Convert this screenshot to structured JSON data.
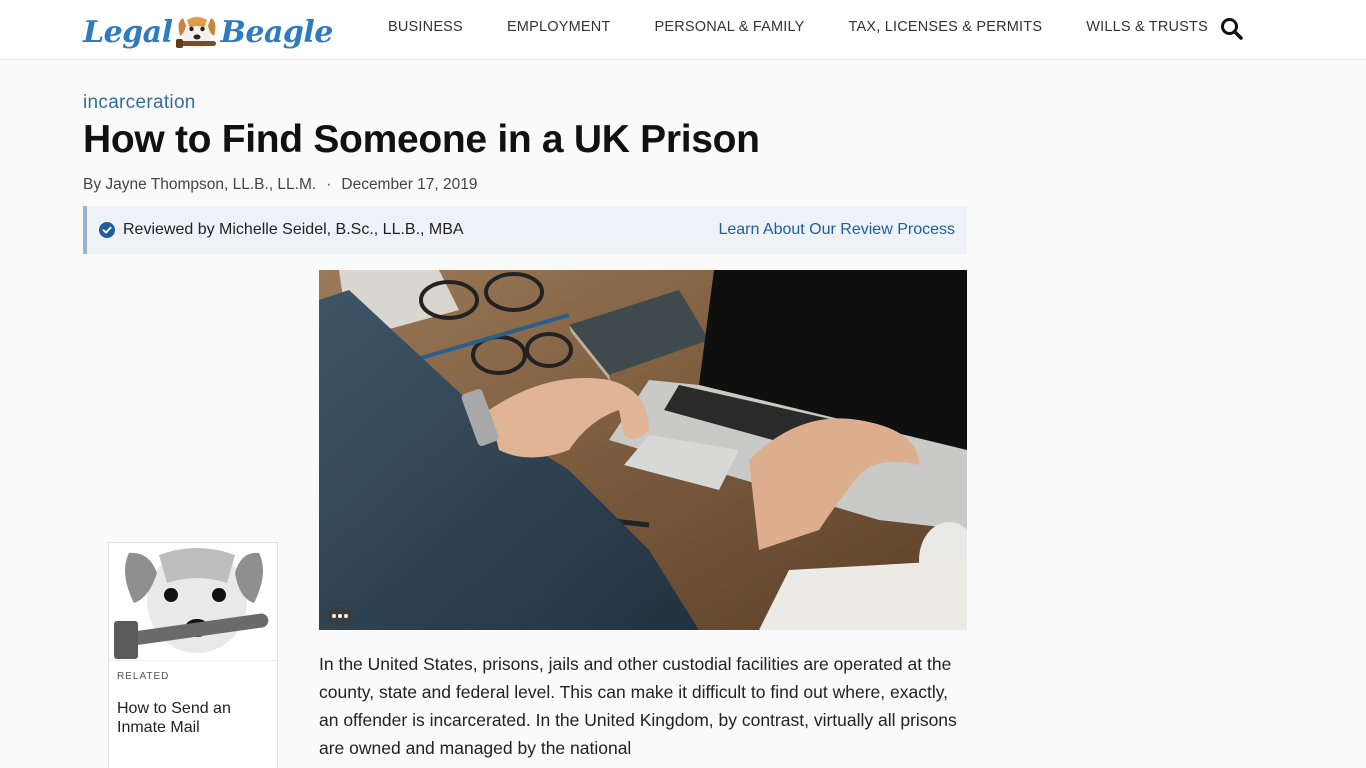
{
  "header": {
    "logo_left": "Legal",
    "logo_right": "Beagle",
    "nav": [
      {
        "label": "BUSINESS"
      },
      {
        "label": "EMPLOYMENT"
      },
      {
        "label": "PERSONAL & FAMILY"
      },
      {
        "label": "TAX, LICENSES & PERMITS"
      },
      {
        "label": "WILLS & TRUSTS"
      }
    ],
    "search_icon": "search-icon"
  },
  "article": {
    "category": "incarceration",
    "title": "How to Find Someone in a UK Prison",
    "author": "By Jayne Thompson, LL.B., LL.M.",
    "separator": "·",
    "date": "December 17, 2019",
    "reviewed_by": "Reviewed by Michelle Seidel, B.Sc., LL.B., MBA",
    "review_link": "Learn About Our Review Process",
    "body": "In the United States, prisons, jails and other custodial facilities are operated at the county, state and federal level. This can make it difficult to find out where, exactly, an offender is incarcerated. In the United Kingdom, by contrast, virtually all prisons are owned and managed by the national"
  },
  "related": {
    "label": "RELATED",
    "title": "How to Send an Inmate Mail"
  },
  "colors": {
    "brand_blue": "#2e7bbf",
    "link_blue": "#1d5f9c",
    "review_bg": "#eef2f7"
  }
}
